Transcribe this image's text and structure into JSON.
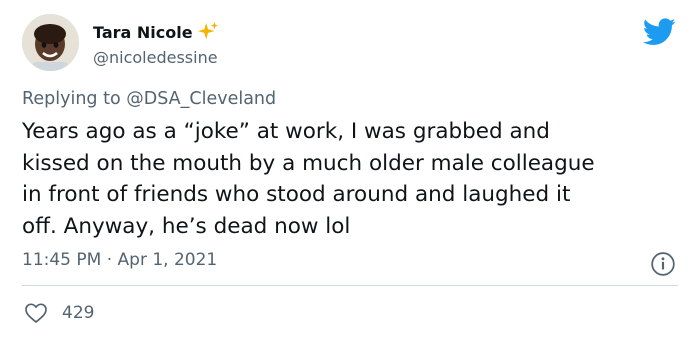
{
  "author": {
    "display_name": "Tara Nicole",
    "handle": "@nicoledessine"
  },
  "reply": {
    "prefix": "Replying to",
    "mention": "@DSA_Cleveland"
  },
  "tweet": {
    "text": "Years ago as a “joke” at work, I was grabbed and\nkissed on the mouth by a much older male colleague\nin front of friends who stood around and laughed it\noff. Anyway, he’s dead now lol",
    "timestamp": "11:45 PM · Apr 1, 2021"
  },
  "engagement": {
    "likes": "429"
  },
  "icons": {
    "logo": "twitter-bird-icon",
    "info": "info-icon",
    "like": "heart-icon",
    "verified_emoji": "sparkles-icon"
  },
  "colors": {
    "brand_blue": "#1d9bf0",
    "text_primary": "#0f1419",
    "text_secondary": "#536471",
    "divider": "#cfd9de",
    "sparkle": "#f5b301"
  }
}
